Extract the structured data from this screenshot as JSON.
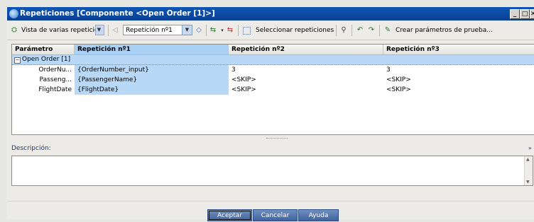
{
  "window": {
    "title": "Repeticiones [Componente <Open Order [1]>]",
    "min_glyph": "_",
    "max_glyph": "□",
    "close_glyph": "✕"
  },
  "toolbar": {
    "view_label": "Vista de varias repeticio",
    "iteration_combo": "Repetición nº1",
    "select_label": "Seleccionar repeticiones",
    "create_label": "Crear parámetros de prueba..."
  },
  "grid": {
    "headers": [
      "Parámetro",
      "Repetición nº1",
      "Repetición nº2",
      "Repetición nº3"
    ],
    "group": "Open Order [1]",
    "rows": [
      {
        "param": "OrderNu...",
        "r1": "{OrderNumber_input}",
        "r2": "3",
        "r3": "3"
      },
      {
        "param": "Passeng...",
        "r1": "{PassengerName}",
        "r2": "<SKIP>",
        "r3": "<SKIP>"
      },
      {
        "param": "FlightDate",
        "r1": "{FlightDate}",
        "r2": "<SKIP>",
        "r3": "<SKIP>"
      }
    ]
  },
  "description": {
    "label": "Descripción:",
    "value": ""
  },
  "buttons": {
    "accept": "Aceptar",
    "cancel": "Cancelar",
    "help": "Ayuda"
  },
  "colors": {
    "title_bar": "#0e56b4",
    "selection": "#b8d8f8",
    "button": "#4f72ad"
  }
}
